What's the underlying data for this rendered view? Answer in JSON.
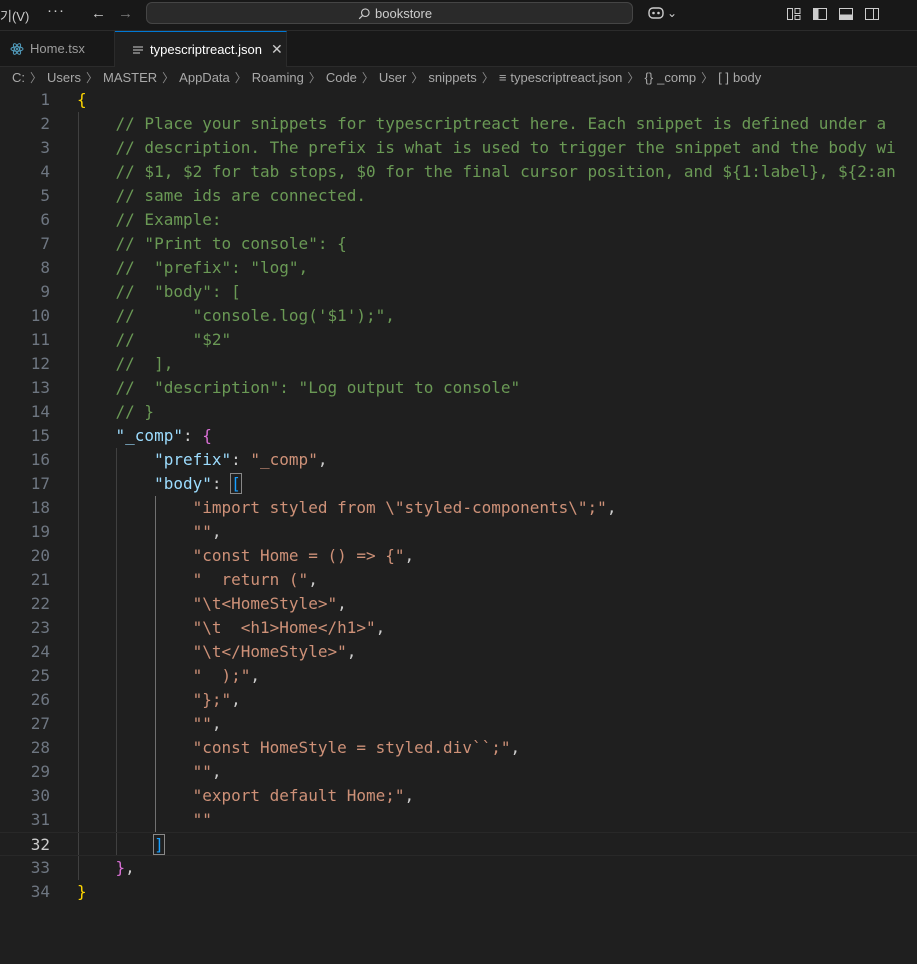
{
  "titlebar": {
    "menu_label": "기(V)",
    "more_label": "···",
    "back_label": "←",
    "forward_label": "→",
    "search_text": "bookstore",
    "copilot_chevron": "⌄"
  },
  "tabs": [
    {
      "label": "Home.tsx",
      "icon": "react-icon",
      "active": false
    },
    {
      "label": "typescriptreact.json",
      "icon": "json-file-icon",
      "active": true,
      "close": "✕"
    }
  ],
  "breadcrumb": [
    "C:",
    "Users",
    "MASTER",
    "AppData",
    "Roaming",
    "Code",
    "User",
    "snippets",
    "typescriptreact.json",
    "_comp",
    "body"
  ],
  "breadcrumb_icons": {
    "file": "≡",
    "object": "{}",
    "array": "[ ]"
  },
  "editor": {
    "active_line": 32,
    "lines": [
      {
        "n": "1",
        "tokens": [
          [
            "{",
            "b1"
          ]
        ]
      },
      {
        "n": "2",
        "tokens": [
          [
            "    ",
            "pun"
          ],
          [
            "// Place your snippets for typescriptreact here. Each snippet is defined under a",
            "com"
          ]
        ]
      },
      {
        "n": "3",
        "tokens": [
          [
            "    ",
            "pun"
          ],
          [
            "// description. The prefix is what is used to trigger the snippet and the body wi",
            "com"
          ]
        ]
      },
      {
        "n": "4",
        "tokens": [
          [
            "    ",
            "pun"
          ],
          [
            "// $1, $2 for tab stops, $0 for the final cursor position, and ${1:label}, ${2:an",
            "com"
          ]
        ]
      },
      {
        "n": "5",
        "tokens": [
          [
            "    ",
            "pun"
          ],
          [
            "// same ids are connected.",
            "com"
          ]
        ]
      },
      {
        "n": "6",
        "tokens": [
          [
            "    ",
            "pun"
          ],
          [
            "// Example:",
            "com"
          ]
        ]
      },
      {
        "n": "7",
        "tokens": [
          [
            "    ",
            "pun"
          ],
          [
            "// \"Print to console\": {",
            "com"
          ]
        ]
      },
      {
        "n": "8",
        "tokens": [
          [
            "    ",
            "pun"
          ],
          [
            "//  \"prefix\": \"log\",",
            "com"
          ]
        ]
      },
      {
        "n": "9",
        "tokens": [
          [
            "    ",
            "pun"
          ],
          [
            "//  \"body\": [",
            "com"
          ]
        ]
      },
      {
        "n": "10",
        "tokens": [
          [
            "    ",
            "pun"
          ],
          [
            "//      \"console.log('$1');\",",
            "com"
          ]
        ]
      },
      {
        "n": "11",
        "tokens": [
          [
            "    ",
            "pun"
          ],
          [
            "//      \"$2\"",
            "com"
          ]
        ]
      },
      {
        "n": "12",
        "tokens": [
          [
            "    ",
            "pun"
          ],
          [
            "//  ],",
            "com"
          ]
        ]
      },
      {
        "n": "13",
        "tokens": [
          [
            "    ",
            "pun"
          ],
          [
            "//  \"description\": \"Log output to console\"",
            "com"
          ]
        ]
      },
      {
        "n": "14",
        "tokens": [
          [
            "    ",
            "pun"
          ],
          [
            "// }",
            "com"
          ]
        ]
      },
      {
        "n": "15",
        "tokens": [
          [
            "    ",
            "pun"
          ],
          [
            "\"_comp\"",
            "key"
          ],
          [
            ": ",
            "pun"
          ],
          [
            "{",
            "b2"
          ]
        ]
      },
      {
        "n": "16",
        "tokens": [
          [
            "        ",
            "pun"
          ],
          [
            "\"prefix\"",
            "key"
          ],
          [
            ": ",
            "pun"
          ],
          [
            "\"_comp\"",
            "str"
          ],
          [
            ",",
            "pun"
          ]
        ]
      },
      {
        "n": "17",
        "tokens": [
          [
            "        ",
            "pun"
          ],
          [
            "\"body\"",
            "key"
          ],
          [
            ": ",
            "pun"
          ],
          [
            "[",
            "b3m"
          ]
        ]
      },
      {
        "n": "18",
        "tokens": [
          [
            "            ",
            "pun"
          ],
          [
            "\"import styled from \\\"styled-components\\\";\"",
            "str"
          ],
          [
            ",",
            "pun"
          ]
        ]
      },
      {
        "n": "19",
        "tokens": [
          [
            "            ",
            "pun"
          ],
          [
            "\"\"",
            "str"
          ],
          [
            ",",
            "pun"
          ]
        ]
      },
      {
        "n": "20",
        "tokens": [
          [
            "            ",
            "pun"
          ],
          [
            "\"const Home = () => {\"",
            "str"
          ],
          [
            ",",
            "pun"
          ]
        ]
      },
      {
        "n": "21",
        "tokens": [
          [
            "            ",
            "pun"
          ],
          [
            "\"  return (\"",
            "str"
          ],
          [
            ",",
            "pun"
          ]
        ]
      },
      {
        "n": "22",
        "tokens": [
          [
            "            ",
            "pun"
          ],
          [
            "\"\\t<HomeStyle>\"",
            "str"
          ],
          [
            ",",
            "pun"
          ]
        ]
      },
      {
        "n": "23",
        "tokens": [
          [
            "            ",
            "pun"
          ],
          [
            "\"\\t  <h1>Home</h1>\"",
            "str"
          ],
          [
            ",",
            "pun"
          ]
        ]
      },
      {
        "n": "24",
        "tokens": [
          [
            "            ",
            "pun"
          ],
          [
            "\"\\t</HomeStyle>\"",
            "str"
          ],
          [
            ",",
            "pun"
          ]
        ]
      },
      {
        "n": "25",
        "tokens": [
          [
            "            ",
            "pun"
          ],
          [
            "\"  );\"",
            "str"
          ],
          [
            ",",
            "pun"
          ]
        ]
      },
      {
        "n": "26",
        "tokens": [
          [
            "            ",
            "pun"
          ],
          [
            "\"};\"",
            "str"
          ],
          [
            ",",
            "pun"
          ]
        ]
      },
      {
        "n": "27",
        "tokens": [
          [
            "            ",
            "pun"
          ],
          [
            "\"\"",
            "str"
          ],
          [
            ",",
            "pun"
          ]
        ]
      },
      {
        "n": "28",
        "tokens": [
          [
            "            ",
            "pun"
          ],
          [
            "\"const HomeStyle = styled.div``;\"",
            "str"
          ],
          [
            ",",
            "pun"
          ]
        ]
      },
      {
        "n": "29",
        "tokens": [
          [
            "            ",
            "pun"
          ],
          [
            "\"\"",
            "str"
          ],
          [
            ",",
            "pun"
          ]
        ]
      },
      {
        "n": "30",
        "tokens": [
          [
            "            ",
            "pun"
          ],
          [
            "\"export default Home;\"",
            "str"
          ],
          [
            ",",
            "pun"
          ]
        ]
      },
      {
        "n": "31",
        "tokens": [
          [
            "            ",
            "pun"
          ],
          [
            "\"\"",
            "str"
          ]
        ]
      },
      {
        "n": "32",
        "tokens": [
          [
            "        ",
            "pun"
          ],
          [
            "]",
            "b3m"
          ]
        ]
      },
      {
        "n": "33",
        "tokens": [
          [
            "    ",
            "pun"
          ],
          [
            "}",
            "b2"
          ],
          [
            ",",
            "pun"
          ]
        ]
      },
      {
        "n": "34",
        "tokens": [
          [
            "}",
            "b1"
          ]
        ]
      }
    ]
  }
}
